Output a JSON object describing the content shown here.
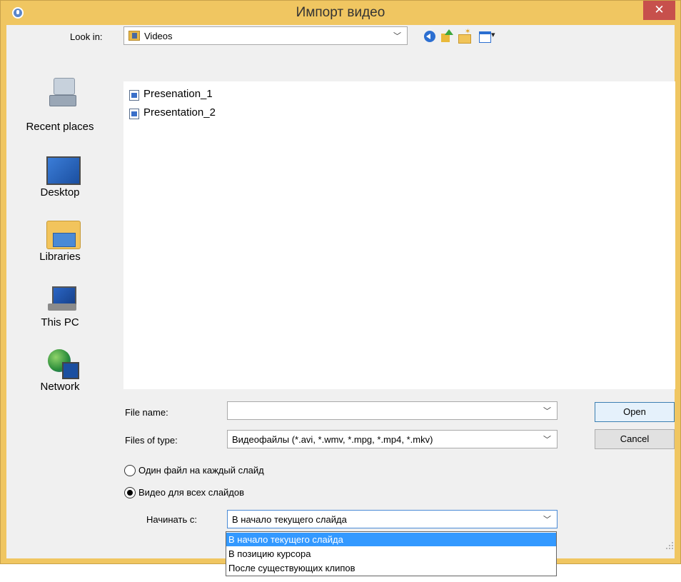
{
  "window": {
    "title": "Импорт видео",
    "close_glyph": "✕",
    "title_icon": "stopwatch-icon",
    "accent_color": "#f0c661",
    "close_color": "#c7504c"
  },
  "lookin": {
    "label": "Look in:",
    "value": "Videos",
    "folder_icon": "video-folder-icon"
  },
  "toolbar": {
    "back_icon": "back-arrow-icon",
    "up_icon": "up-folder-icon",
    "new_folder_icon": "new-folder-icon",
    "views_icon": "view-menu-icon"
  },
  "places": [
    {
      "label": "Recent places",
      "icon": "recent-places-icon"
    },
    {
      "label": "Desktop",
      "icon": "desktop-icon"
    },
    {
      "label": "Libraries",
      "icon": "libraries-icon"
    },
    {
      "label": "This PC",
      "icon": "this-pc-icon"
    },
    {
      "label": "Network",
      "icon": "network-icon"
    }
  ],
  "files": [
    {
      "name": "Presenation_1",
      "icon": "video-file-icon"
    },
    {
      "name": "Presentation_2",
      "icon": "video-file-icon"
    }
  ],
  "filename": {
    "label": "File name:",
    "value": ""
  },
  "filetype": {
    "label": "Files of type:",
    "value": "Видеофайлы (*.avi, *.wmv, *.mpg, *.mp4, *.mkv)"
  },
  "buttons": {
    "open": "Open",
    "cancel": "Cancel"
  },
  "options": {
    "per_slide": "Один файл на каждый слайд",
    "all_slides": "Видео для всех слайдов",
    "selected": "all_slides"
  },
  "start": {
    "label": "Начинать с:",
    "value": "В начало текущего слайда",
    "dropdown_items": [
      "В начало текущего слайда",
      "В позицию курсора",
      "После существующих клипов"
    ],
    "highlight_color": "#3399ff"
  }
}
